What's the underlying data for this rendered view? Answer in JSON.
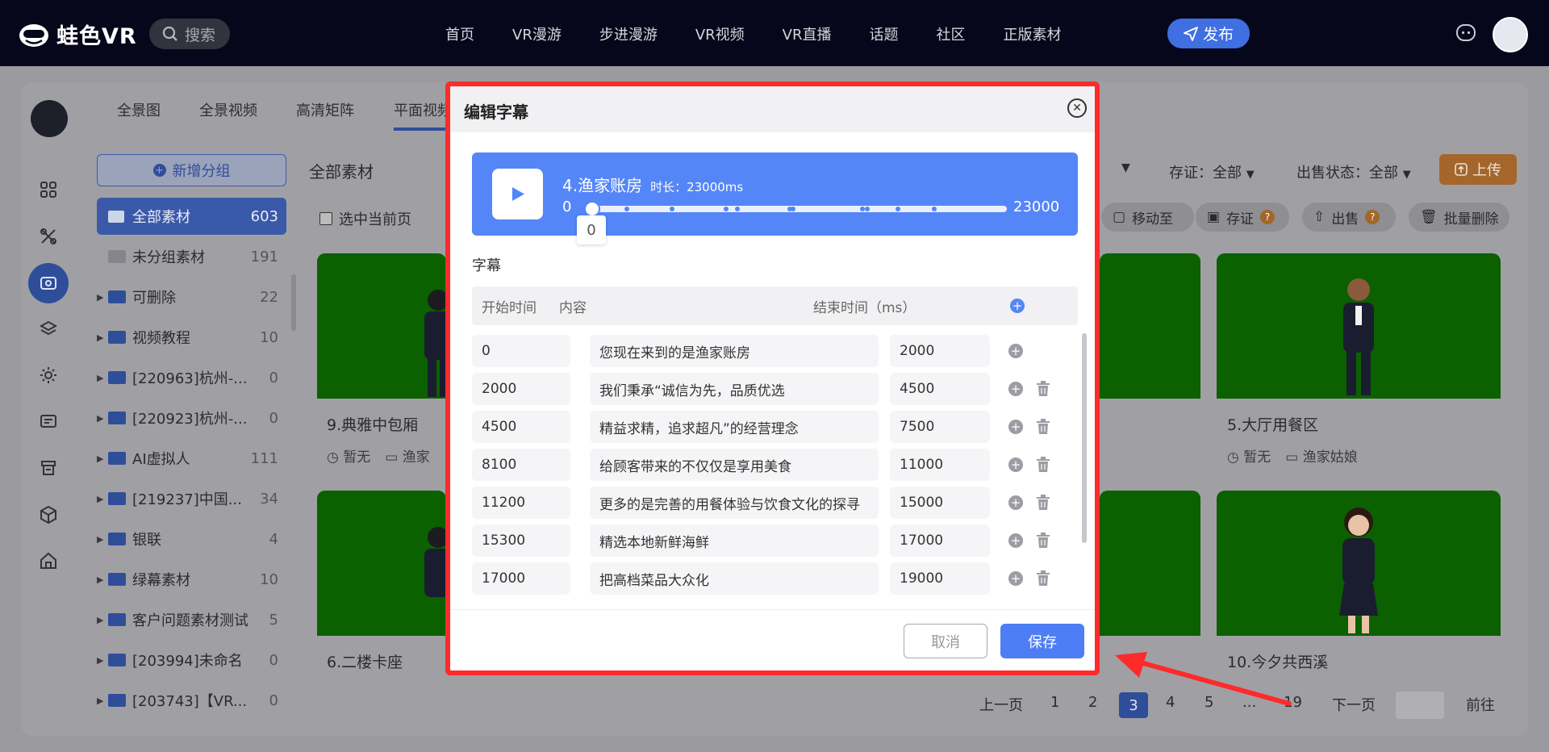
{
  "header": {
    "brand": "蛙色VR",
    "search_label": "搜索",
    "nav": [
      "首页",
      "VR漫游",
      "步进漫游",
      "VR视频",
      "VR直播",
      "话题",
      "社区",
      "正版素材"
    ],
    "publish_label": "发布"
  },
  "subtabs": [
    "全景图",
    "全景视频",
    "高清矩阵",
    "平面视频"
  ],
  "sidebar": {
    "new_group_label": "新增分组",
    "all": {
      "label": "全部素材",
      "count": "603"
    },
    "items": [
      {
        "label": "未分组素材",
        "count": "191"
      },
      {
        "label": "可删除",
        "count": "22"
      },
      {
        "label": "视频教程",
        "count": "10"
      },
      {
        "label": "[220963]杭州-...",
        "count": "0"
      },
      {
        "label": "[220923]杭州-...",
        "count": "0"
      },
      {
        "label": "AI虚拟人",
        "count": "111"
      },
      {
        "label": "[219237]中国...",
        "count": "34"
      },
      {
        "label": "银联",
        "count": "4"
      },
      {
        "label": "绿幕素材",
        "count": "10"
      },
      {
        "label": "客户问题素材测试",
        "count": "5"
      },
      {
        "label": "[203994]未命名",
        "count": "0"
      },
      {
        "label": "[203743]【VR...",
        "count": "0"
      }
    ]
  },
  "content": {
    "breadcrumb": "全部素材",
    "select_page_label": "选中当前页",
    "filter_cert": "存证：全部",
    "filter_sale": "出售状态：全部",
    "upload_label": "上传",
    "actions": [
      "移动至",
      "存证",
      "出售",
      "批量删除"
    ],
    "cards": [
      {
        "title": "9.典雅中包厢",
        "meta1": "暂无",
        "meta2": "渔家"
      },
      {
        "title": "5.大厅用餐区",
        "meta1": "暂无",
        "meta2": "渔家姑娘"
      },
      {
        "title": "6.二楼卡座",
        "meta1": "",
        "meta2": ""
      },
      {
        "title": "10.今夕共西溪",
        "meta1": "",
        "meta2": ""
      }
    ]
  },
  "pager": {
    "prev": "上一页",
    "pages": [
      "1",
      "2",
      "3",
      "4",
      "5",
      "...",
      "19"
    ],
    "current": "3",
    "next": "下一页",
    "goto": "前往"
  },
  "modal": {
    "title": "编辑字幕",
    "player": {
      "title": "4.渔家账房",
      "duration": "时长：23000ms",
      "start": "0",
      "end": "23000",
      "tooltip": "0",
      "position_fraction": 0
    },
    "section_label": "字幕",
    "columns": {
      "start": "开始时间",
      "content": "内容",
      "end": "结束时间（ms）"
    },
    "rows": [
      {
        "start": "0",
        "text": "您现在来到的是渔家账房",
        "end": "2000"
      },
      {
        "start": "2000",
        "text": "我们秉承“诚信为先，品质优选",
        "end": "4500"
      },
      {
        "start": "4500",
        "text": "精益求精，追求超凡”的经营理念",
        "end": "7500"
      },
      {
        "start": "8100",
        "text": "给顾客带来的不仅仅是享用美食",
        "end": "11000"
      },
      {
        "start": "11200",
        "text": "更多的是完善的用餐体验与饮食文化的探寻",
        "end": "15000"
      },
      {
        "start": "15300",
        "text": "精选本地新鲜海鲜",
        "end": "17000"
      },
      {
        "start": "17000",
        "text": "把高档菜品大众化",
        "end": "19000"
      }
    ],
    "cancel_label": "取消",
    "save_label": "保存"
  },
  "colors": {
    "accent": "#4d7ef5",
    "highlight_border": "#ff2a2a",
    "header_bg": "#06071a",
    "green_screen": "#0b6000"
  }
}
